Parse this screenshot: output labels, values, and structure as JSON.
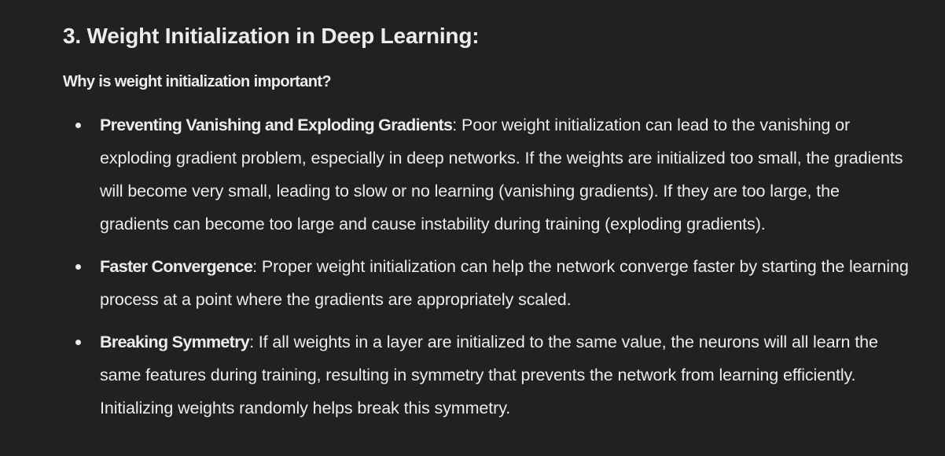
{
  "heading": "3. Weight Initialization in Deep Learning:",
  "subheading": "Why is weight initialization important?",
  "items": [
    {
      "title": "Preventing Vanishing and Exploding Gradients",
      "text": ": Poor weight initialization can lead to the vanishing or exploding gradient problem, especially in deep networks. If the weights are initialized too small, the gradients will become very small, leading to slow or no learning (vanishing gradients). If they are too large, the gradients can become too large and cause instability during training (exploding gradients)."
    },
    {
      "title": "Faster Convergence",
      "text": ": Proper weight initialization can help the network converge faster by starting the learning process at a point where the gradients are appropriately scaled."
    },
    {
      "title": "Breaking Symmetry",
      "text": ": If all weights in a layer are initialized to the same value, the neurons will all learn the same features during training, resulting in symmetry that prevents the network from learning efficiently. Initializing weights randomly helps break this symmetry."
    }
  ]
}
